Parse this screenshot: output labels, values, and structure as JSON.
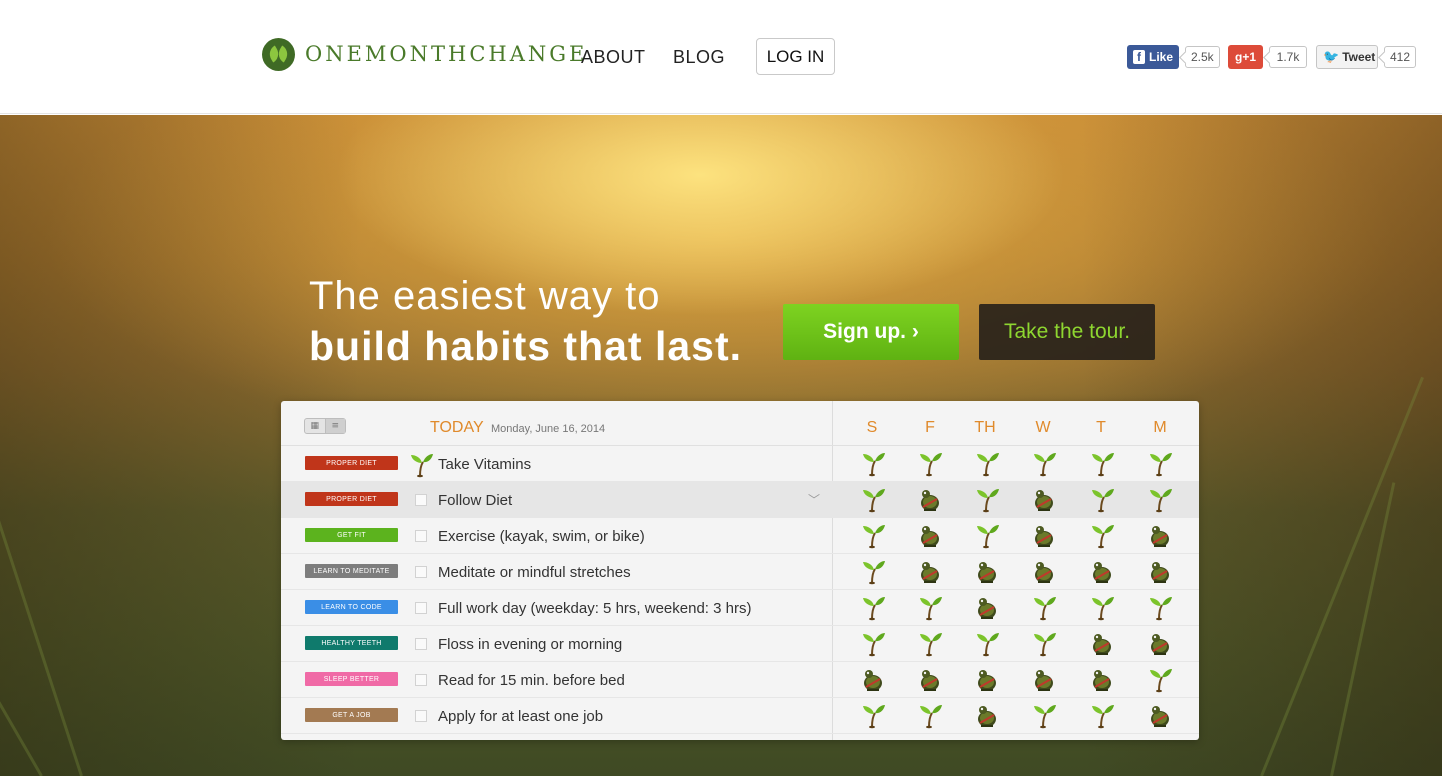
{
  "header": {
    "logo_text": "ONEMONTHCHANGE",
    "nav": {
      "about": "ABOUT",
      "blog": "BLOG"
    },
    "login": "LOG IN",
    "social": {
      "facebook": {
        "label": "Like",
        "count": "2.5k"
      },
      "googleplus": {
        "label": "g+1",
        "count": "1.7k"
      },
      "twitter": {
        "label": "Tweet",
        "count": "412"
      }
    }
  },
  "hero": {
    "headline_line1": "The easiest way to",
    "headline_line2": "build habits that last.",
    "signup": "Sign up. ›",
    "tour": "Take the tour."
  },
  "tracker": {
    "today_label": "TODAY",
    "today_date": "Monday, June 16, 2014",
    "days": [
      "S",
      "F",
      "TH",
      "W",
      "T",
      "M"
    ],
    "habits": [
      {
        "tag": "PROPER DIET",
        "tag_color": "#c0351a",
        "text": "Take Vitamins",
        "done_today": true,
        "history": [
          "sprout",
          "sprout",
          "sprout",
          "sprout",
          "sprout",
          "sprout"
        ]
      },
      {
        "tag": "PROPER DIET",
        "tag_color": "#c0351a",
        "text": "Follow Diet",
        "done_today": false,
        "highlight": true,
        "history": [
          "sprout",
          "bug",
          "sprout",
          "bug",
          "sprout",
          "sprout"
        ]
      },
      {
        "tag": "GET FIT",
        "tag_color": "#5cb31e",
        "text": "Exercise (kayak, swim, or bike)",
        "done_today": false,
        "history": [
          "sprout",
          "bug",
          "sprout",
          "bug",
          "sprout",
          "bug"
        ]
      },
      {
        "tag": "LEARN TO MEDITATE",
        "tag_color": "#7d7d7d",
        "text": "Meditate or mindful stretches",
        "done_today": false,
        "history": [
          "sprout",
          "bug",
          "bug",
          "bug",
          "bug",
          "bug"
        ]
      },
      {
        "tag": "LEARN TO CODE",
        "tag_color": "#3a8ee6",
        "text": "Full work day (weekday: 5 hrs, weekend: 3 hrs)",
        "done_today": false,
        "history": [
          "sprout",
          "sprout",
          "bug",
          "sprout",
          "sprout",
          "sprout"
        ]
      },
      {
        "tag": "HEALTHY TEETH",
        "tag_color": "#0f7a6c",
        "text": "Floss in evening or morning",
        "done_today": false,
        "history": [
          "sprout",
          "sprout",
          "sprout",
          "sprout",
          "bug",
          "bug"
        ]
      },
      {
        "tag": "SLEEP BETTER",
        "tag_color": "#f06aa6",
        "text": "Read for 15 min. before bed",
        "done_today": false,
        "history": [
          "bug",
          "bug",
          "bug",
          "bug",
          "bug",
          "sprout"
        ]
      },
      {
        "tag": "GET A JOB",
        "tag_color": "#a37a52",
        "text": "Apply for at least one job",
        "done_today": false,
        "history": [
          "sprout",
          "sprout",
          "bug",
          "sprout",
          "sprout",
          "bug"
        ]
      }
    ]
  }
}
